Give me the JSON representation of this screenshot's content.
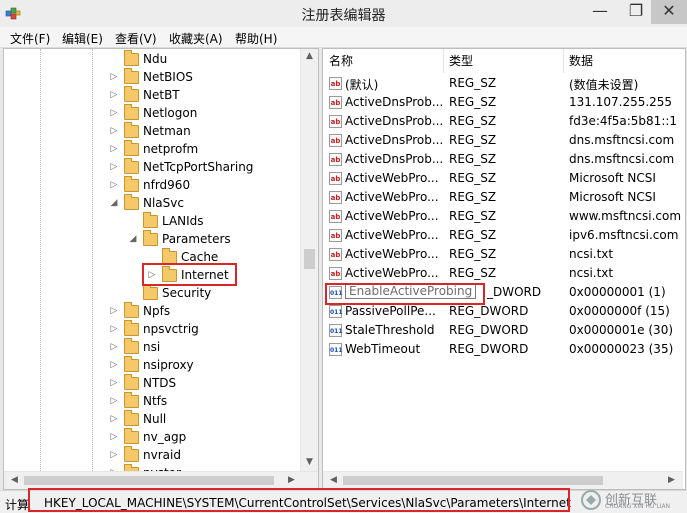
{
  "window": {
    "title": "注册表编辑器",
    "minimize": "—",
    "restore": "❐"
  },
  "menu": [
    "文件(F)",
    "编辑(E)",
    "查看(V)",
    "收藏夹(A)",
    "帮助(H)"
  ],
  "tree": [
    {
      "label": "Ndu",
      "level": 0,
      "expander": ""
    },
    {
      "label": "NetBIOS",
      "level": 0,
      "expander": "▷"
    },
    {
      "label": "NetBT",
      "level": 0,
      "expander": "▷"
    },
    {
      "label": "Netlogon",
      "level": 0,
      "expander": "▷"
    },
    {
      "label": "Netman",
      "level": 0,
      "expander": "▷"
    },
    {
      "label": "netprofm",
      "level": 0,
      "expander": "▷"
    },
    {
      "label": "NetTcpPortSharing",
      "level": 0,
      "expander": "▷"
    },
    {
      "label": "nfrd960",
      "level": 0,
      "expander": "▷"
    },
    {
      "label": "NlaSvc",
      "level": 0,
      "expander": "◢"
    },
    {
      "label": "LANIds",
      "level": 1,
      "expander": ""
    },
    {
      "label": "Parameters",
      "level": 1,
      "expander": "◢"
    },
    {
      "label": "Cache",
      "level": 2,
      "expander": ""
    },
    {
      "label": "Internet",
      "level": 2,
      "expander": "▷"
    },
    {
      "label": "Security",
      "level": 1,
      "expander": ""
    },
    {
      "label": "Npfs",
      "level": 0,
      "expander": "▷"
    },
    {
      "label": "npsvctrig",
      "level": 0,
      "expander": "▷"
    },
    {
      "label": "nsi",
      "level": 0,
      "expander": "▷"
    },
    {
      "label": "nsiproxy",
      "level": 0,
      "expander": "▷"
    },
    {
      "label": "NTDS",
      "level": 0,
      "expander": "▷"
    },
    {
      "label": "Ntfs",
      "level": 0,
      "expander": "▷"
    },
    {
      "label": "Null",
      "level": 0,
      "expander": "▷"
    },
    {
      "label": "nv_agp",
      "level": 0,
      "expander": "▷"
    },
    {
      "label": "nvraid",
      "level": 0,
      "expander": "▷"
    },
    {
      "label": "nvstor",
      "level": 0,
      "expander": "▷"
    }
  ],
  "columns": {
    "name": "名称",
    "type": "类型",
    "data": "数据"
  },
  "values": [
    {
      "icon": "ab",
      "name": "(默认)",
      "type": "REG_SZ",
      "data": "(数值未设置)"
    },
    {
      "icon": "ab",
      "name": "ActiveDnsProb...",
      "type": "REG_SZ",
      "data": "131.107.255.255"
    },
    {
      "icon": "ab",
      "name": "ActiveDnsProb...",
      "type": "REG_SZ",
      "data": "fd3e:4f5a:5b81::1"
    },
    {
      "icon": "ab",
      "name": "ActiveDnsProb...",
      "type": "REG_SZ",
      "data": "dns.msftncsi.com"
    },
    {
      "icon": "ab",
      "name": "ActiveDnsProb...",
      "type": "REG_SZ",
      "data": "dns.msftncsi.com"
    },
    {
      "icon": "ab",
      "name": "ActiveWebPro...",
      "type": "REG_SZ",
      "data": "Microsoft NCSI"
    },
    {
      "icon": "ab",
      "name": "ActiveWebPro...",
      "type": "REG_SZ",
      "data": "Microsoft NCSI"
    },
    {
      "icon": "ab",
      "name": "ActiveWebPro...",
      "type": "REG_SZ",
      "data": "www.msftncsi.com"
    },
    {
      "icon": "ab",
      "name": "ActiveWebPro...",
      "type": "REG_SZ",
      "data": "ipv6.msftncsi.com"
    },
    {
      "icon": "ab",
      "name": "ActiveWebPro...",
      "type": "REG_SZ",
      "data": "ncsi.txt"
    },
    {
      "icon": "ab",
      "name": "ActiveWebPro...",
      "type": "REG_SZ",
      "data": "ncsi.txt"
    },
    {
      "icon": "011",
      "name": "EnableActiveProbing",
      "type": "_DWORD",
      "data": "0x00000001 (1)"
    },
    {
      "icon": "011",
      "name": "PassivePollPe...",
      "type": "REG_DWORD",
      "data": "0x0000000f (15)"
    },
    {
      "icon": "011",
      "name": "StaleThreshold",
      "type": "REG_DWORD",
      "data": "0x0000001e (30)"
    },
    {
      "icon": "011",
      "name": "WebTimeout",
      "type": "REG_DWORD",
      "data": "0x00000023 (35)"
    }
  ],
  "status": {
    "prefix": "计算",
    "path": "HKEY_LOCAL_MACHINE\\SYSTEM\\CurrentControlSet\\Services\\NlaSvc\\Parameters\\Internet"
  },
  "watermark": {
    "cn": "创新互联",
    "en": "CHUANG XIN HU LIAN"
  }
}
